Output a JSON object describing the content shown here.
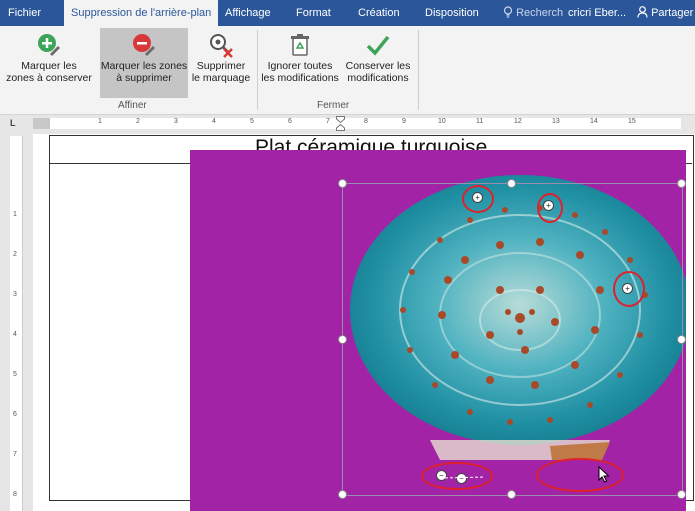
{
  "tabs": [
    {
      "label": "Fichier"
    },
    {
      "label": "Suppression de l'arrière-plan"
    },
    {
      "label": "Affichage"
    },
    {
      "label": "Format"
    },
    {
      "label": "Création"
    },
    {
      "label": "Disposition"
    }
  ],
  "search": {
    "placeholder": "Recherch"
  },
  "user": {
    "name": "cricri Eber..."
  },
  "share": {
    "label": "Partager"
  },
  "ribbon": {
    "buttons": [
      {
        "line1": "Marquer les",
        "line2": "zones à conserver",
        "icon": "plus-pencil-icon"
      },
      {
        "line1": "Marquer les zones",
        "line2": "à supprimer",
        "icon": "minus-pencil-icon"
      },
      {
        "line1": "Supprimer",
        "line2": "le marquage",
        "icon": "delete-mark-icon"
      },
      {
        "line1": "Ignorer toutes",
        "line2": "les modifications",
        "icon": "recycle-bin-icon"
      },
      {
        "line1": "Conserver les",
        "line2": "modifications",
        "icon": "checkmark-icon"
      }
    ],
    "groups": {
      "affiner": "Affiner",
      "fermer": "Fermer"
    }
  },
  "ruler": {
    "h_numbers": [
      "1",
      "2",
      "3",
      "4",
      "5",
      "6",
      "7",
      "8",
      "9",
      "10",
      "11",
      "12",
      "13",
      "14",
      "15"
    ],
    "v_numbers": [
      "1",
      "2",
      "3",
      "4",
      "5",
      "6",
      "7",
      "8"
    ]
  },
  "document": {
    "title": "Plat céramique turquoise"
  },
  "colors": {
    "accent": "#2b579a",
    "background_removal": "#a223a6",
    "mark_circle": "#e0202a"
  }
}
